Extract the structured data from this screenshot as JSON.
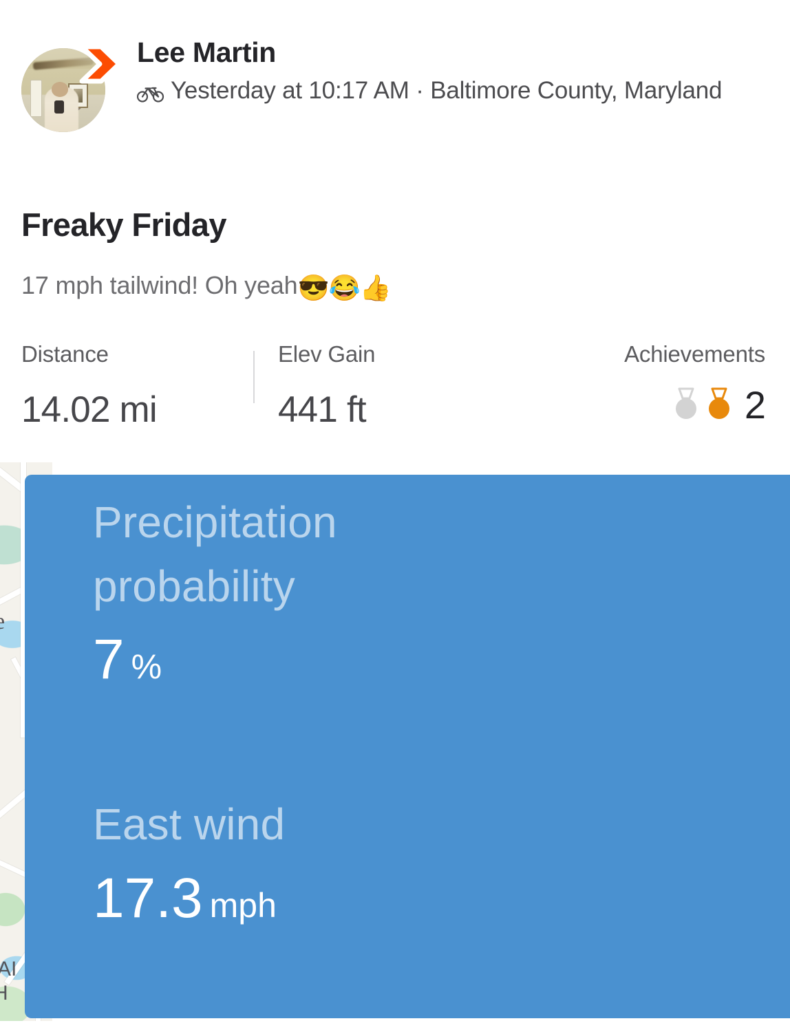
{
  "header": {
    "athlete_name": "Lee Martin",
    "activity_icon": "bicycle-icon",
    "brand_icon": "strava-chevron-icon",
    "meta": "Yesterday at 10:17 AM · Baltimore County, Maryland",
    "avatar_alt": "athlete-avatar"
  },
  "activity": {
    "title": "Freaky Friday",
    "description": "17 mph tailwind! Oh yeah",
    "emojis": "😎😂👍"
  },
  "stats": {
    "distance": {
      "label": "Distance",
      "value": "14.02 mi"
    },
    "elevation": {
      "label": "Elev Gain",
      "value": "441 ft"
    },
    "achievements": {
      "label": "Achievements",
      "count": "2",
      "medals": [
        "silver-medal-icon",
        "gold-medal-icon"
      ]
    }
  },
  "weather": {
    "precipitation": {
      "label": "Precipitation probability",
      "value": "7",
      "unit": "%"
    },
    "wind": {
      "label": "East wind",
      "value": "17.3",
      "unit": "mph"
    }
  },
  "map": {
    "label_1": "e",
    "label_2": "AI",
    "label_3": "H"
  },
  "colors": {
    "brand_orange": "#FC4C02",
    "weather_blue": "#4a91d0",
    "text_primary": "#242428",
    "text_secondary": "#6d6d70",
    "medal_gold": "#E8890C",
    "medal_silver": "#D3D3D3"
  }
}
